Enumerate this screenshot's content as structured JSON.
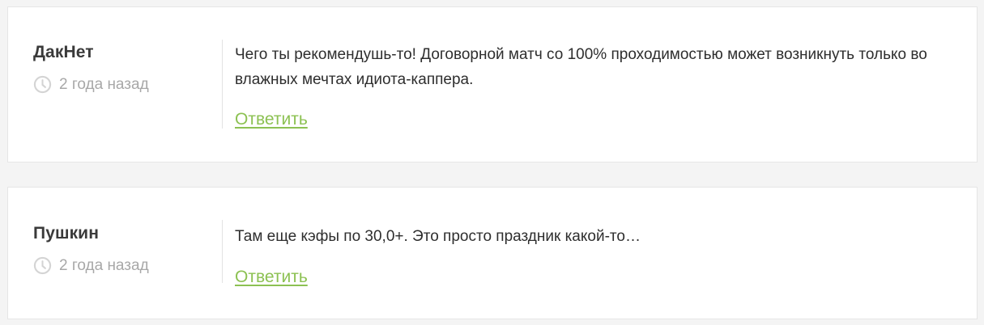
{
  "comments": [
    {
      "author": "ДакНет",
      "date": "2 года назад",
      "text": "Чего ты рекомендушь-то! Договорной матч со 100% проходимостью может возникнуть только во влажных мечтах идиота-каппера.",
      "reply_label": "Ответить"
    },
    {
      "author": "Пушкин",
      "date": "2 года назад",
      "text": "Там еще кэфы по 30,0+. Это просто праздник какой-то…",
      "reply_label": "Ответить"
    }
  ],
  "colors": {
    "reply_link": "#8cc152",
    "author": "#3a3a3a",
    "meta_text": "#a8a8a8",
    "body_text": "#2e2e2e",
    "background": "#f4f4f4",
    "card": "#ffffff"
  },
  "icons": {
    "date": "clock-icon"
  }
}
